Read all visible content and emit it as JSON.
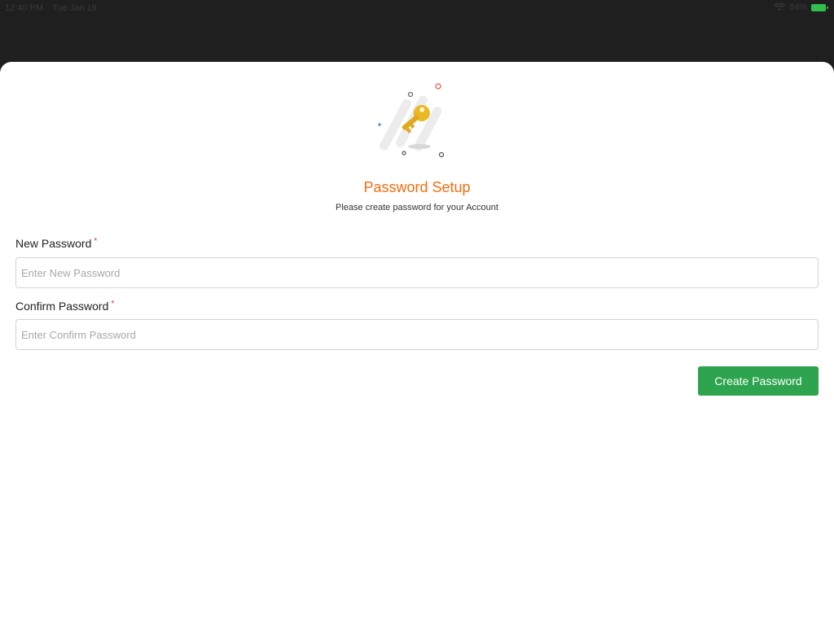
{
  "status_bar": {
    "time": "12:40 PM",
    "date": "Tue Jan 19",
    "battery": "84%",
    "wifi_icon": "wifi-icon",
    "battery_icon": "battery-charging-icon"
  },
  "header": {
    "illustration_icon": "key-icon",
    "title": "Password Setup",
    "subtitle": "Please create password for your Account"
  },
  "form": {
    "new_password": {
      "label": "New Password",
      "required_mark": "*",
      "value": "",
      "placeholder": "Enter New Password"
    },
    "confirm_password": {
      "label": "Confirm Password",
      "required_mark": "*",
      "value": "",
      "placeholder": "Enter Confirm Password"
    },
    "submit_label": "Create Password"
  },
  "colors": {
    "title": "#f26d10",
    "button": "#2ea44f",
    "required": "#e03030",
    "backdrop": "#1f1f1f"
  }
}
